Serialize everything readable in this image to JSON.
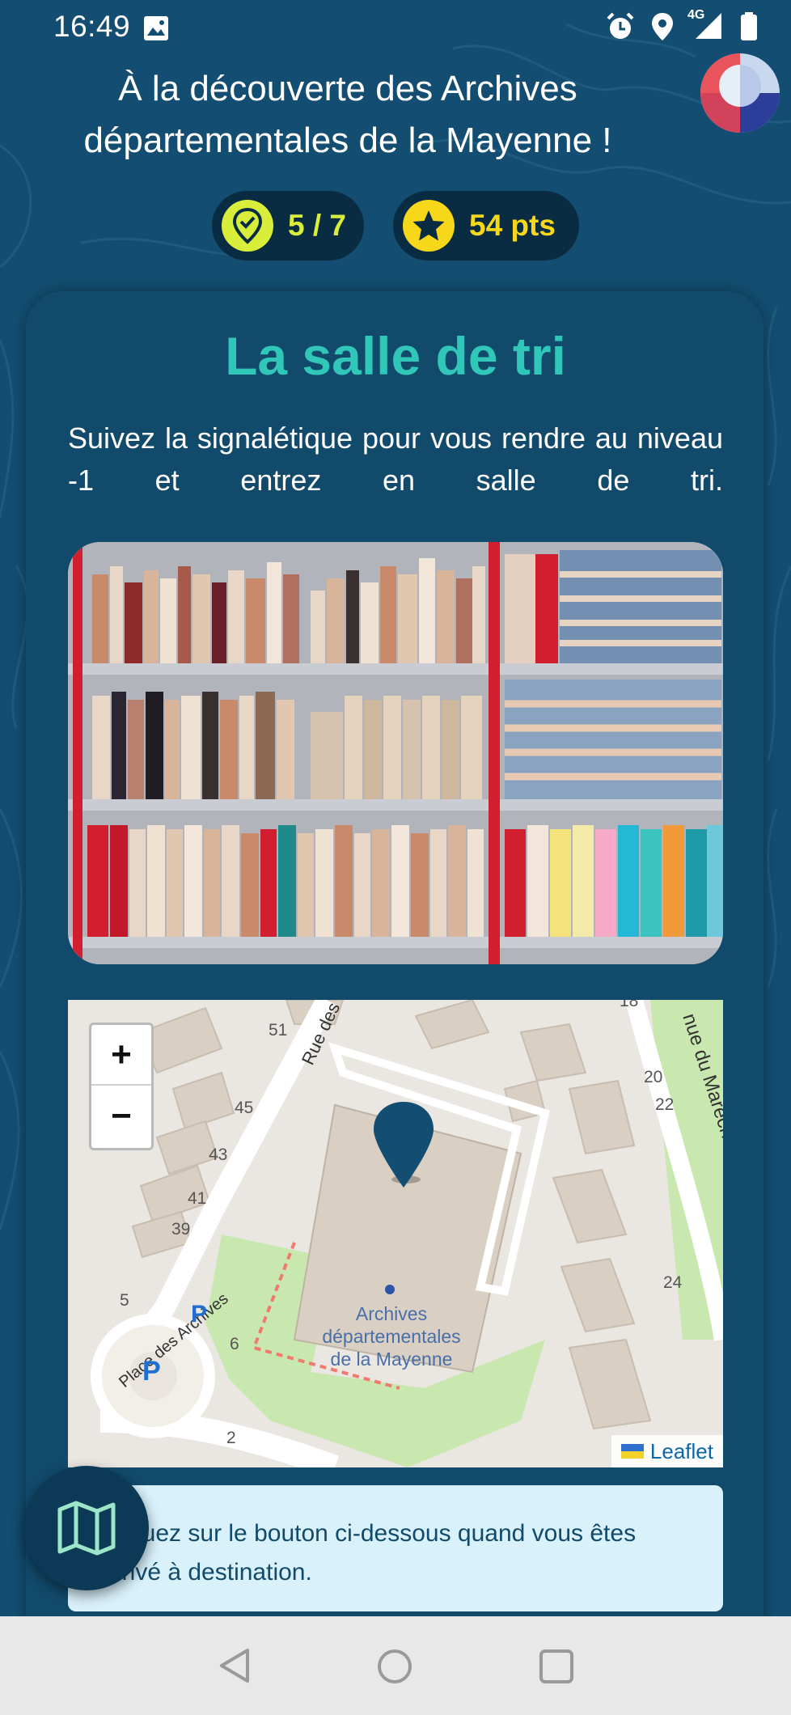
{
  "status_bar": {
    "time": "16:49",
    "network": "4G",
    "icons": [
      "gallery-icon",
      "alarm-icon",
      "location-icon",
      "signal-icon",
      "battery-icon"
    ]
  },
  "header": {
    "title": "À la découverte des Archives départementales de la Mayenne !",
    "progress": "5 / 7",
    "points": "54 pts"
  },
  "step": {
    "title": "La salle de tri",
    "description": "Suivez la signalétique pour vous rendre au niveau -1 et entrez en salle de tri."
  },
  "map": {
    "zoom_in": "+",
    "zoom_out": "−",
    "attribution": "Leaflet",
    "labels": {
      "rue_top": "Rue des",
      "avenue": "nue du Maréchal Leclerc",
      "place": "Place des Archives",
      "building": [
        "Archives",
        "départementales",
        "de la Mayenne"
      ],
      "numbers": [
        "51",
        "45",
        "43",
        "41",
        "39",
        "5",
        "6",
        "2",
        "20",
        "22",
        "24",
        "18"
      ]
    }
  },
  "info": {
    "text": "Cliquez sur le bouton ci-dessous quand vous êtes arrivé à destination."
  },
  "colors": {
    "background": "#134e72",
    "accent_title": "#31c7b8",
    "progress_badge": "#d9ee3a",
    "points_badge": "#f6d719",
    "info_box": "#d9f1fb"
  }
}
